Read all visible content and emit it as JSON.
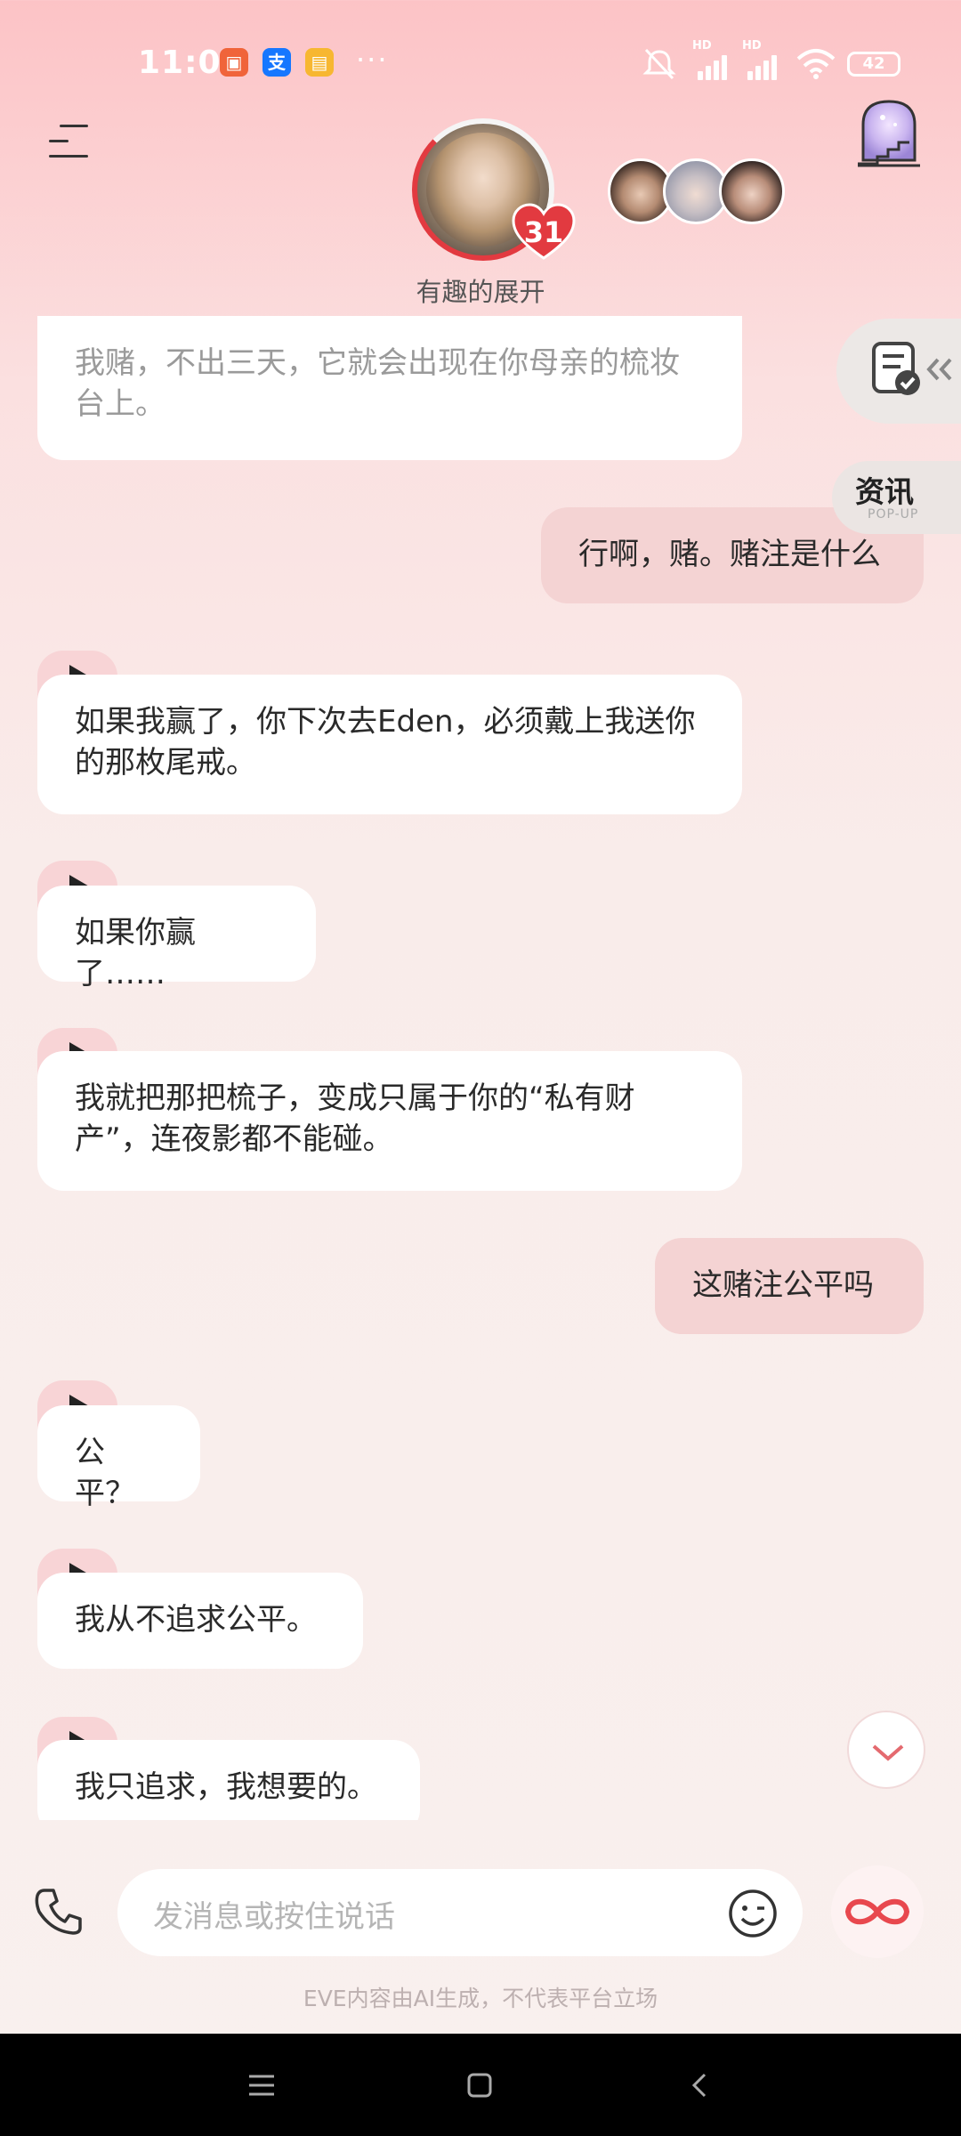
{
  "status_bar": {
    "time": "11:00",
    "battery": "42",
    "dots": "···",
    "hd1": "HD",
    "hd2": "HD"
  },
  "header": {
    "chat_name": "有趣的展开",
    "heart_count": "31"
  },
  "side": {
    "news_title": "资讯",
    "news_sub": "POP-UP"
  },
  "messages": [
    {
      "side": "left",
      "text": "我赌，不出三天，它就会出现在你母亲的梳妆台上。"
    },
    {
      "side": "right",
      "text": "行啊，赌。赌注是什么"
    },
    {
      "side": "left",
      "text": "如果我赢了，你下次去Eden，必须戴上我送你的那枚尾戒。"
    },
    {
      "side": "left",
      "text": "如果你赢了……"
    },
    {
      "side": "left",
      "text": "我就把那把梳子，变成只属于你的“私有财产”，连夜影都不能碰。"
    },
    {
      "side": "right",
      "text": "这赌注公平吗"
    },
    {
      "side": "left",
      "text": "公平？"
    },
    {
      "side": "left",
      "text": "我从不追求公平。"
    },
    {
      "side": "left",
      "text": "我只追求，我想要的。"
    }
  ],
  "input": {
    "placeholder": "发消息或按住说话"
  },
  "footer": {
    "disclaimer": "EVE内容由AI生成，不代表平台立场"
  },
  "colors": {
    "accent": "#e23a40",
    "bubble_right": "#f4d3d3",
    "play_tab": "#f8d4d6"
  }
}
